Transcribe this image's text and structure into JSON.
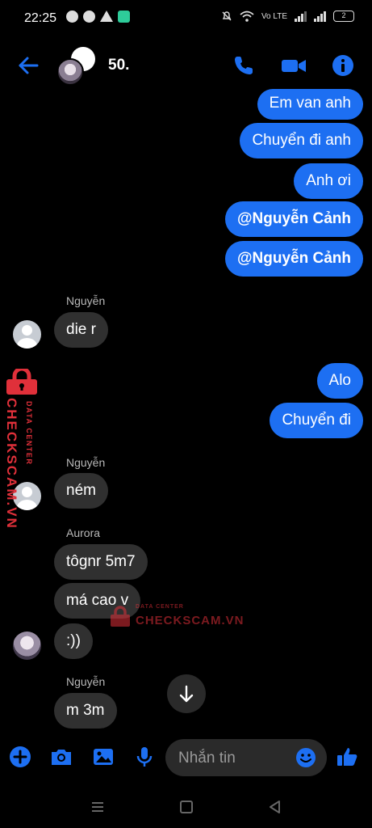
{
  "status_bar": {
    "time": "22:25",
    "network": "Vo LTE",
    "battery": "2"
  },
  "header": {
    "title": "50.",
    "icons": [
      "back-arrow-icon",
      "phone-icon",
      "video-camera-icon",
      "info-icon"
    ]
  },
  "messages": [
    {
      "direction": "out",
      "text": "Em van anh"
    },
    {
      "direction": "out",
      "text": "Chuyển đi anh"
    },
    {
      "direction": "out",
      "text": "Anh ơi"
    },
    {
      "direction": "out",
      "text": "@Nguyễn Cảnh",
      "bold": true
    },
    {
      "direction": "out",
      "text": "@Nguyễn Cảnh",
      "bold": true
    },
    {
      "direction": "in",
      "sender": "Nguyễn",
      "text": "die r"
    },
    {
      "direction": "out",
      "text": "Alo"
    },
    {
      "direction": "out",
      "text": "Chuyển đi"
    },
    {
      "direction": "in",
      "sender": "Nguyễn",
      "text": "ném"
    },
    {
      "direction": "in",
      "sender": "Aurora",
      "text": "tôgnr 5m7"
    },
    {
      "direction": "in",
      "text": "má cao v"
    },
    {
      "direction": "in",
      "text": ":))"
    },
    {
      "direction": "in",
      "sender": "Nguyễn",
      "text": "m 3m"
    }
  ],
  "watermark": {
    "main": "CHECKSCAM.VN",
    "sub": "DATA CENTER"
  },
  "composer": {
    "placeholder": "Nhắn tin",
    "icons": [
      "plus-icon",
      "camera-icon",
      "gallery-icon",
      "microphone-icon",
      "emoji-icon",
      "thumbs-up-icon"
    ]
  },
  "colors": {
    "accent": "#1d6ff2",
    "incoming_bubble": "#303030",
    "watermark": "#e0303a"
  }
}
